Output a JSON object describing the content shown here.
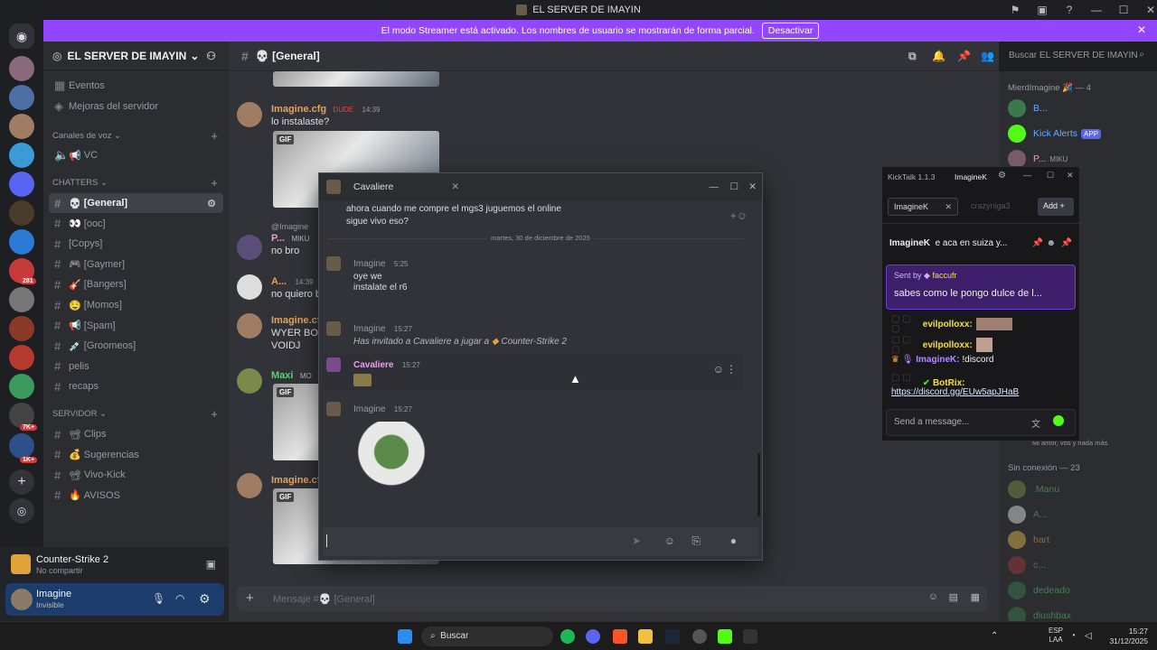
{
  "window": {
    "title": "EL SERVER DE IMAYIN"
  },
  "streamer_banner": {
    "text": "El modo Streamer está activado. Los nombres de usuario se mostrarán de forma parcial.",
    "button": "Desactivar"
  },
  "server": {
    "name": "EL SERVER DE IMAYIN"
  },
  "channels": {
    "top": [
      {
        "label": "Eventos"
      },
      {
        "label": "Mejoras del servidor"
      }
    ],
    "voice_category": "Canales de voz",
    "voice": [
      {
        "label": "VC",
        "emoji": "📢"
      }
    ],
    "chatters_category": "CHATTERS",
    "chatters": [
      {
        "label": "[General]",
        "emoji": "💀",
        "active": true
      },
      {
        "label": "[ooc]",
        "emoji": "👀"
      },
      {
        "label": "[Copys]",
        "emoji": ""
      },
      {
        "label": "[Gaymer]",
        "emoji": "🎮"
      },
      {
        "label": "[Bangers]",
        "emoji": "🎸"
      },
      {
        "label": "[Momos]",
        "emoji": "🤤"
      },
      {
        "label": "[Spam]",
        "emoji": "📢"
      },
      {
        "label": "[Groomeos]",
        "emoji": "💉"
      },
      {
        "label": "pelis",
        "emoji": ""
      },
      {
        "label": "recaps",
        "emoji": ""
      }
    ],
    "server_category": "SERVIDOR",
    "servidor": [
      {
        "label": "Clips",
        "emoji": "📽"
      },
      {
        "label": "Sugerencias",
        "emoji": "💰"
      },
      {
        "label": "Vivo-Kick",
        "emoji": "📽"
      },
      {
        "label": "AVISOS",
        "emoji": "🔥"
      }
    ]
  },
  "activity": {
    "game": "Counter-Strike 2",
    "status": "No compartir"
  },
  "user": {
    "name": "Imagine",
    "status": "Invisible"
  },
  "chat": {
    "channel_title": "💀 [General]",
    "search_placeholder": "Buscar EL SERVER DE IMAYIN",
    "input_placeholder": "Mensaje #💀 [General]",
    "messages": [
      {
        "user": "Imagine.cfg",
        "badge": "DUDE",
        "time": "14:39",
        "text": "lo instalaste?",
        "gif": "GIF"
      },
      {
        "user": "P...",
        "badge": "MIKU",
        "reply": "@Imagine",
        "text": "no bro"
      },
      {
        "user": "A...",
        "time": "14:39",
        "text": "no quiero b"
      },
      {
        "user": "Imagine.cfg",
        "text": "WYER BOW",
        "text2": "VOIDJ"
      },
      {
        "user": "Maxi",
        "badge": "MO",
        "gif": "GIF"
      },
      {
        "user": "Imagine.cfg",
        "gif": "GIF"
      }
    ]
  },
  "members": {
    "online_header": "MierdImagine 🎉 — 4",
    "online": [
      {
        "name": "B..."
      },
      {
        "name": "Kick Alerts",
        "tag": "APP"
      },
      {
        "name": "P...",
        "tag": "MIKU"
      }
    ],
    "offline_header": "Sin conexión — 23",
    "offline": [
      {
        "name": ".Manu"
      },
      {
        "name": "A..."
      },
      {
        "name": "bart"
      },
      {
        "name": "c..."
      },
      {
        "name": "dedeado"
      },
      {
        "name": "diushbax"
      }
    ],
    "status_snippet": "Mi amor, vos y nada más."
  },
  "dm_popup": {
    "title": "Cavaliere",
    "messages": [
      {
        "text": "ahora cuando me compre el mgs3 juguemos el online",
        "text2": "sigue vivo eso?"
      },
      {
        "divider": "martes, 30 de diciembre de 2025"
      },
      {
        "user": "Imagine",
        "time": "5:25",
        "text": "oye we",
        "text2": "instalate el r6"
      },
      {
        "user": "Imagine",
        "time": "15:27",
        "text": "Has invitado a Cavaliere a jugar a",
        "game": "Counter-Strike 2"
      },
      {
        "user": "Cavaliere",
        "time": "15:27"
      },
      {
        "user": "Imagine",
        "time": "15:27"
      }
    ]
  },
  "kicktalk": {
    "title": "KickTalk 1.1.3",
    "user_tab": "ImagineK",
    "tabs": [
      {
        "label": "ImagineK"
      },
      {
        "label": "crazyniga3"
      }
    ],
    "add_label": "Add",
    "pinned": {
      "user": "ImagineK",
      "text": "e aca en suiza y..."
    },
    "reply": {
      "prefix": "Sent by",
      "user": "faccufr",
      "text": "sabes como le pongo dulce de l..."
    },
    "lines": [
      {
        "user": "evilpolloxx:",
        "color": "#f5e03d"
      },
      {
        "user": "evilpolloxx:",
        "color": "#f5e03d"
      },
      {
        "user": "ImagineK:",
        "text": "!discord",
        "color": "#b28bff"
      },
      {
        "user": "BotRix:",
        "text": "https://discord.gg/EUw5apJHaB",
        "color": "#f5e03d"
      }
    ],
    "send_placeholder": "Send a message..."
  },
  "taskbar": {
    "search": "Buscar",
    "lang": "ESP",
    "lang2": "LAA",
    "time": "15:27",
    "date": "31/12/2025"
  }
}
